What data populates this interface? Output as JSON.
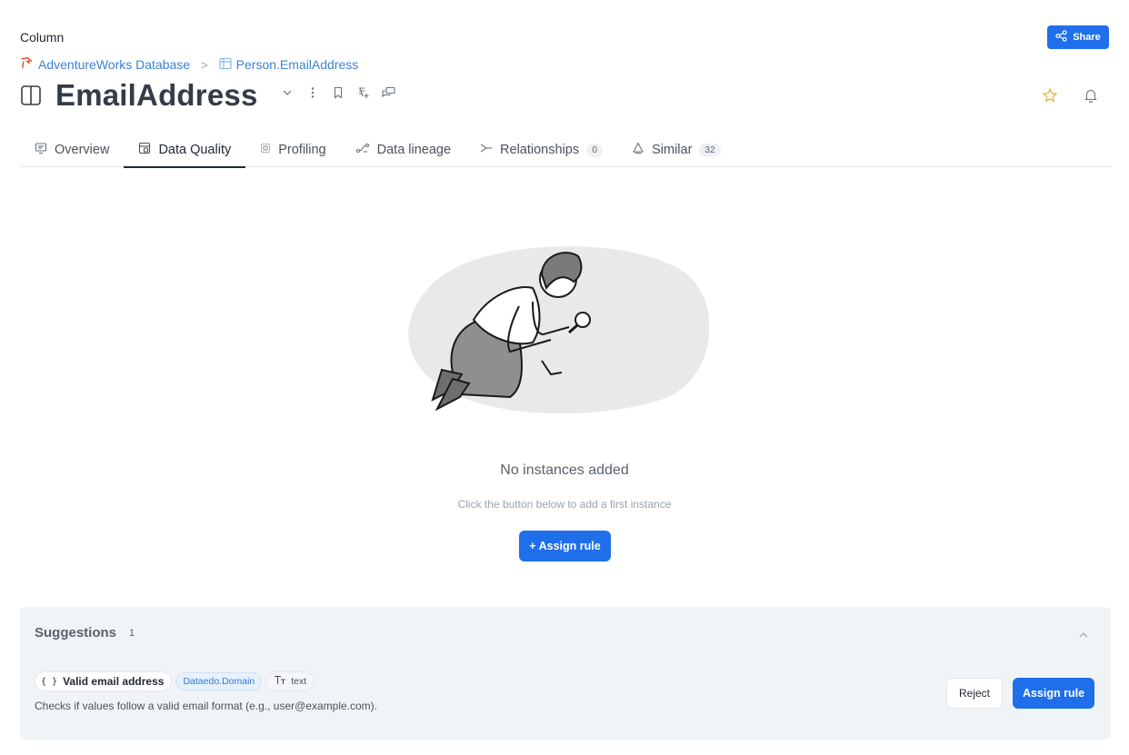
{
  "header": {
    "object_type": "Column",
    "share_label": "Share",
    "breadcrumb": [
      {
        "label": "AdventureWorks Database",
        "icon": "database-icon"
      },
      {
        "label": "Person.EmailAddress",
        "icon": "table-icon"
      }
    ],
    "breadcrumb_separator": ">",
    "title": "EmailAddress",
    "title_icon": "column-icon",
    "title_actions": [
      "chevron-down-icon",
      "more-vertical-icon",
      "bookmark-icon",
      "add-term-icon",
      "comments-icon"
    ],
    "right_actions": [
      "star-icon",
      "bell-icon"
    ]
  },
  "tabs": [
    {
      "label": "Overview",
      "icon": "overview-icon",
      "active": false
    },
    {
      "label": "Data Quality",
      "icon": "data-quality-icon",
      "active": true
    },
    {
      "label": "Profiling",
      "icon": "profiling-icon",
      "active": false
    },
    {
      "label": "Data lineage",
      "icon": "lineage-icon",
      "active": false
    },
    {
      "label": "Relationships",
      "icon": "relationships-icon",
      "active": false,
      "count": "0"
    },
    {
      "label": "Similar",
      "icon": "similar-icon",
      "active": false,
      "count": "32"
    }
  ],
  "empty_state": {
    "title": "No instances added",
    "subtitle": "Click the button below to add a first instance",
    "button_label": "+ Assign rule",
    "illustration": "person-searching-magnifier"
  },
  "suggestions": {
    "title": "Suggestions",
    "count": "1",
    "items": [
      {
        "brackets": "{ }",
        "name": "Valid email address",
        "domain": "Dataedo.Domain",
        "type": "text",
        "description": "Checks if values follow a valid email format (e.g., user@example.com).",
        "reject_label": "Reject",
        "assign_label": "Assign rule"
      }
    ]
  },
  "colors": {
    "accent": "#1f6feb",
    "link": "#3b82d6",
    "star": "#e0b13c"
  }
}
